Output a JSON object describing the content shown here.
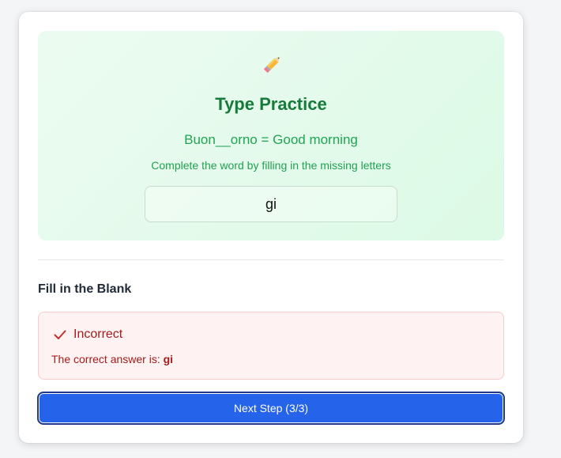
{
  "practice": {
    "icon": "pencil-icon",
    "title": "Type Practice",
    "prompt": "Buon__orno = Good morning",
    "instruction": "Complete the word by filling in the missing letters",
    "input_value": "gi",
    "colors": {
      "title": "#157a3a",
      "text": "#1fa552",
      "background": "#dcfae6"
    }
  },
  "section": {
    "heading": "Fill in the Blank"
  },
  "feedback": {
    "icon": "check-icon",
    "title": "Incorrect",
    "answer_prefix": "The correct answer is: ",
    "answer": "gi",
    "colors": {
      "text": "#a51c1c",
      "background": "#fef2f2",
      "border": "#fbcaca"
    }
  },
  "next_button": {
    "label": "Next Step (3/3)",
    "color": "#2563eb"
  }
}
